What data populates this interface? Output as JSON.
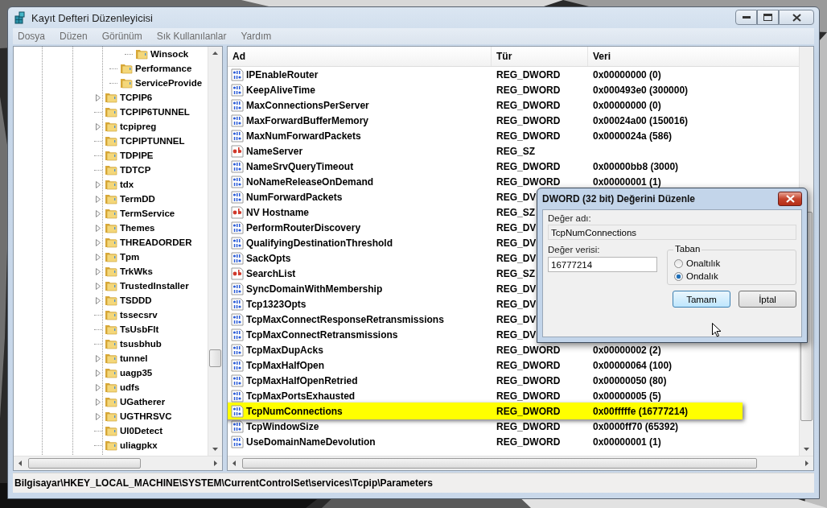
{
  "window": {
    "title": "Kayıt Defteri Düzenleyicisi"
  },
  "menu": [
    "Dosya",
    "Düzen",
    "Görünüm",
    "Sık Kullanılanlar",
    "Yardım"
  ],
  "tree": {
    "items": [
      {
        "children": [
          {
            "children": [
              {
                "label": "Winsock",
                "expandable": false
              }
            ]
          },
          {
            "label": "Performance",
            "expandable": false
          },
          {
            "label": "ServiceProvide",
            "expandable": false
          }
        ]
      },
      {
        "label": "TCPIP6",
        "expandable": true
      },
      {
        "label": "TCPIP6TUNNEL",
        "expandable": false
      },
      {
        "label": "tcpipreg",
        "expandable": true
      },
      {
        "label": "TCPIPTUNNEL",
        "expandable": false
      },
      {
        "label": "TDPIPE",
        "expandable": false
      },
      {
        "label": "TDTCP",
        "expandable": false
      },
      {
        "label": "tdx",
        "expandable": true
      },
      {
        "label": "TermDD",
        "expandable": true
      },
      {
        "label": "TermService",
        "expandable": true
      },
      {
        "label": "Themes",
        "expandable": true
      },
      {
        "label": "THREADORDER",
        "expandable": true
      },
      {
        "label": "Tpm",
        "expandable": true
      },
      {
        "label": "TrkWks",
        "expandable": true
      },
      {
        "label": "TrustedInstaller",
        "expandable": true
      },
      {
        "label": "TSDDD",
        "expandable": true
      },
      {
        "label": "tssecsrv",
        "expandable": false
      },
      {
        "label": "TsUsbFlt",
        "expandable": false
      },
      {
        "label": "tsusbhub",
        "expandable": false
      },
      {
        "label": "tunnel",
        "expandable": true
      },
      {
        "label": "uagp35",
        "expandable": true
      },
      {
        "label": "udfs",
        "expandable": true
      },
      {
        "label": "UGatherer",
        "expandable": true
      },
      {
        "label": "UGTHRSVC",
        "expandable": true
      },
      {
        "label": "UI0Detect",
        "expandable": false
      },
      {
        "label": "uliagpkx",
        "expandable": false
      }
    ]
  },
  "list": {
    "columns": [
      "Ad",
      "Tür",
      "Veri"
    ],
    "rows": [
      {
        "name": "IPEnableRouter",
        "kind": "dword",
        "type": "REG_DWORD",
        "value": "0x00000000 (0)",
        "highlighted": false
      },
      {
        "name": "KeepAliveTime",
        "kind": "dword",
        "type": "REG_DWORD",
        "value": "0x000493e0 (300000)",
        "highlighted": false
      },
      {
        "name": "MaxConnectionsPerServer",
        "kind": "dword",
        "type": "REG_DWORD",
        "value": "0x00000000 (0)",
        "highlighted": false
      },
      {
        "name": "MaxForwardBufferMemory",
        "kind": "dword",
        "type": "REG_DWORD",
        "value": "0x00024a00 (150016)",
        "highlighted": false
      },
      {
        "name": "MaxNumForwardPackets",
        "kind": "dword",
        "type": "REG_DWORD",
        "value": "0x0000024a (586)",
        "highlighted": false
      },
      {
        "name": "NameServer",
        "kind": "sz",
        "type": "REG_SZ",
        "highlighted": false
      },
      {
        "name": "NameSrvQueryTimeout",
        "kind": "dword",
        "type": "REG_DWORD",
        "value": "0x00000bb8 (3000)",
        "highlighted": false
      },
      {
        "name": "NoNameReleaseOnDemand",
        "kind": "dword",
        "type": "REG_DWORD",
        "value": "0x00000001 (1)",
        "highlighted": false
      },
      {
        "name": "NumForwardPackets",
        "kind": "dword",
        "type": "REG_DV",
        "highlighted": false
      },
      {
        "name": "NV Hostname",
        "kind": "sz",
        "type": "REG_SZ",
        "highlighted": false
      },
      {
        "name": "PerformRouterDiscovery",
        "kind": "dword",
        "type": "REG_DV",
        "highlighted": false
      },
      {
        "name": "QualifyingDestinationThreshold",
        "kind": "dword",
        "type": "REG_DV",
        "highlighted": false
      },
      {
        "name": "SackOpts",
        "kind": "dword",
        "type": "REG_DV",
        "highlighted": false
      },
      {
        "name": "SearchList",
        "kind": "sz",
        "type": "REG_SZ",
        "highlighted": false
      },
      {
        "name": "SyncDomainWithMembership",
        "kind": "dword",
        "type": "REG_DV",
        "highlighted": false
      },
      {
        "name": "Tcp1323Opts",
        "kind": "dword",
        "type": "REG_DV",
        "highlighted": false
      },
      {
        "name": "TcpMaxConnectResponseRetransmissions",
        "kind": "dword",
        "type": "REG_DV",
        "highlighted": false
      },
      {
        "name": "TcpMaxConnectRetransmissions",
        "kind": "dword",
        "type": "REG_DV",
        "highlighted": false
      },
      {
        "name": "TcpMaxDupAcks",
        "kind": "dword",
        "type": "REG_DWORD",
        "value": "0x00000002 (2)",
        "highlighted": false
      },
      {
        "name": "TcpMaxHalfOpen",
        "kind": "dword",
        "type": "REG_DWORD",
        "value": "0x00000064 (100)",
        "highlighted": false
      },
      {
        "name": "TcpMaxHalfOpenRetried",
        "kind": "dword",
        "type": "REG_DWORD",
        "value": "0x00000050 (80)",
        "highlighted": false
      },
      {
        "name": "TcpMaxPortsExhausted",
        "kind": "dword",
        "type": "REG_DWORD",
        "value": "0x00000005 (5)",
        "highlighted": false
      },
      {
        "name": "TcpNumConnections",
        "kind": "dword",
        "type": "REG_DWORD",
        "value": "0x00fffffe (16777214)",
        "highlighted": true
      },
      {
        "name": "TcpWindowSize",
        "kind": "dword",
        "type": "REG_DWORD",
        "value": "0x0000ff70 (65392)",
        "highlighted": false
      },
      {
        "name": "UseDomainNameDevolution",
        "kind": "dword",
        "type": "REG_DWORD",
        "value": "0x00000001 (1)",
        "highlighted": false
      }
    ]
  },
  "dialog": {
    "title": "DWORD (32 bit) Değerini Düzenle",
    "name_label": "Değer adı:",
    "name_value": "TcpNumConnections",
    "data_label": "Değer verisi:",
    "data_value": "16777214",
    "base_group": "Taban",
    "radios": [
      {
        "label": "Onaltılık",
        "selected": false
      },
      {
        "label": "Ondalık",
        "selected": true
      }
    ],
    "buttons": [
      {
        "label": "Tamam",
        "focused": true
      },
      {
        "label": "İptal",
        "focused": false
      }
    ]
  },
  "status_bar": "Bilgisayar\\HKEY_LOCAL_MACHINE\\SYSTEM\\CurrentControlSet\\services\\Tcpip\\Parameters"
}
